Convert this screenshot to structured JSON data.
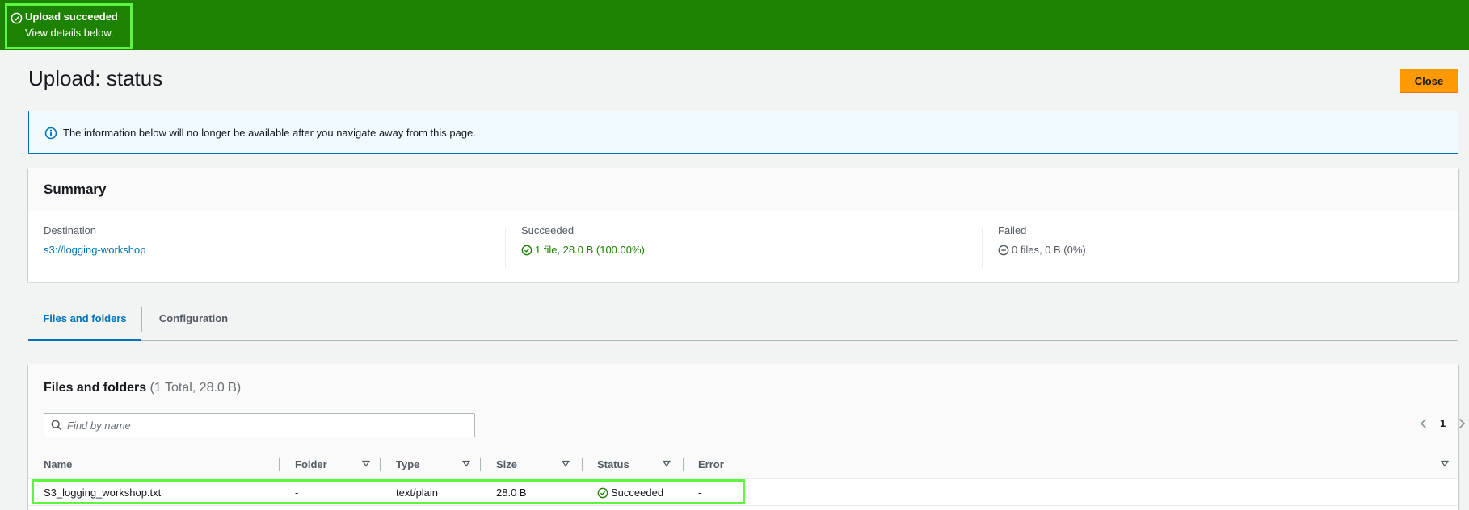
{
  "flash": {
    "title": "Upload succeeded",
    "message": "View details below.",
    "color": "#1d8102"
  },
  "header": {
    "title": "Upload: status",
    "close_label": "Close"
  },
  "alert": {
    "text": "The information below will no longer be available after you navigate away from this page."
  },
  "summary": {
    "title": "Summary",
    "destination_label": "Destination",
    "destination_value": "s3://logging-workshop",
    "succeeded_label": "Succeeded",
    "succeeded_value": "1 file, 28.0 B (100.00%)",
    "failed_label": "Failed",
    "failed_value": "0 files, 0 B (0%)"
  },
  "tabs": [
    {
      "label": "Files and folders",
      "active": true
    },
    {
      "label": "Configuration",
      "active": false
    }
  ],
  "files": {
    "title": "Files and folders",
    "count": "(1 Total, 28.0 B)",
    "search_placeholder": "Find by name",
    "page": "1",
    "columns": [
      "Name",
      "Folder",
      "Type",
      "Size",
      "Status",
      "Error"
    ],
    "rows": [
      {
        "name": "S3_logging_workshop.txt",
        "folder": "-",
        "type": "text/plain",
        "size": "28.0 B",
        "status": "Succeeded",
        "error": "-"
      }
    ]
  },
  "colors": {
    "accent": "#0073bb",
    "success": "#1d8102",
    "primary_button": "#ff9900",
    "highlight": "#5df542"
  }
}
